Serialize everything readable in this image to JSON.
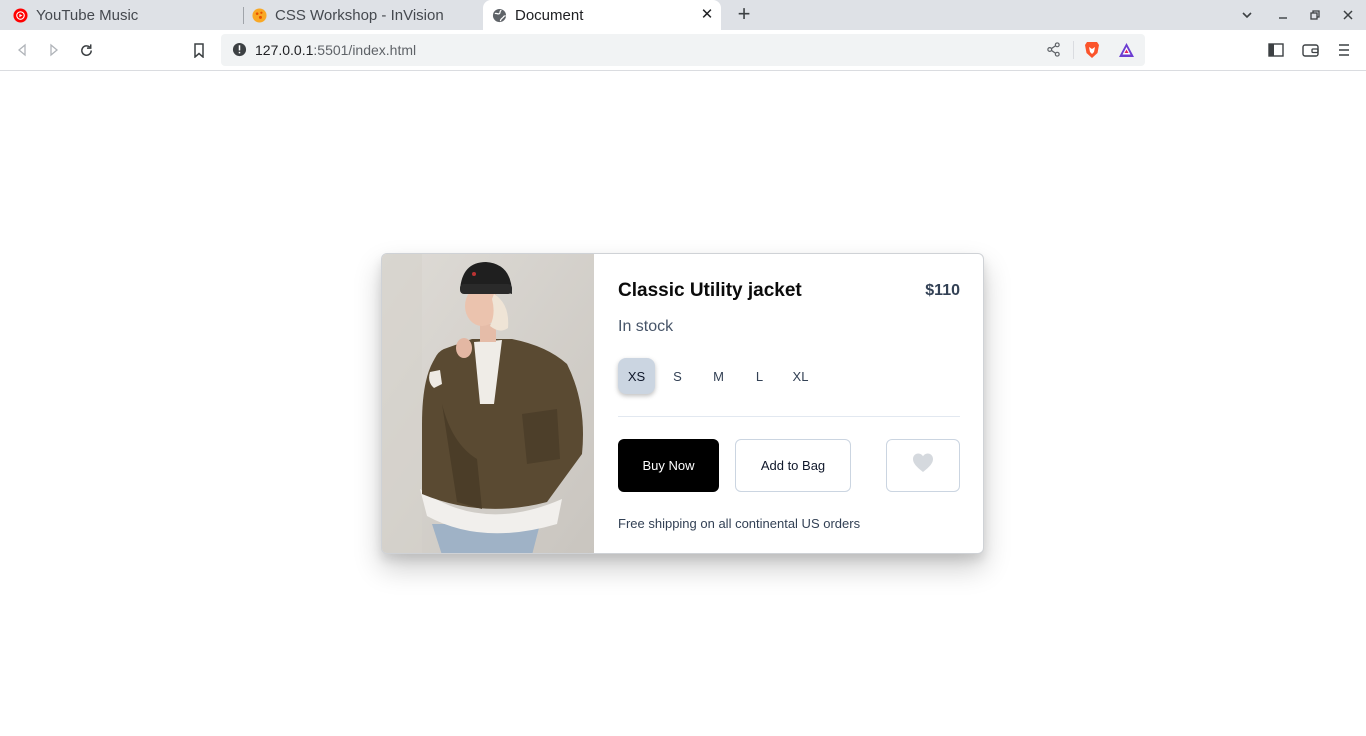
{
  "browser": {
    "tabs": [
      {
        "title": "YouTube Music",
        "icon": "youtube-music-icon"
      },
      {
        "title": "CSS Workshop - InVision",
        "icon": "invision-icon"
      },
      {
        "title": "Document",
        "icon": "globe-icon",
        "active": true
      }
    ],
    "new_tab_label": "+",
    "url_host": "127.0.0.1",
    "url_rest": ":5501/index.html"
  },
  "product": {
    "title": "Classic Utility jacket",
    "price": "$110",
    "stock": "In stock",
    "sizes": [
      "XS",
      "S",
      "M",
      "L",
      "XL"
    ],
    "selected_size": "XS",
    "buy_label": "Buy Now",
    "bag_label": "Add to Bag",
    "shipping_note": "Free shipping on all continental US orders"
  },
  "colors": {
    "buy_bg": "#000000",
    "selected_size_bg": "#cbd5e1"
  }
}
